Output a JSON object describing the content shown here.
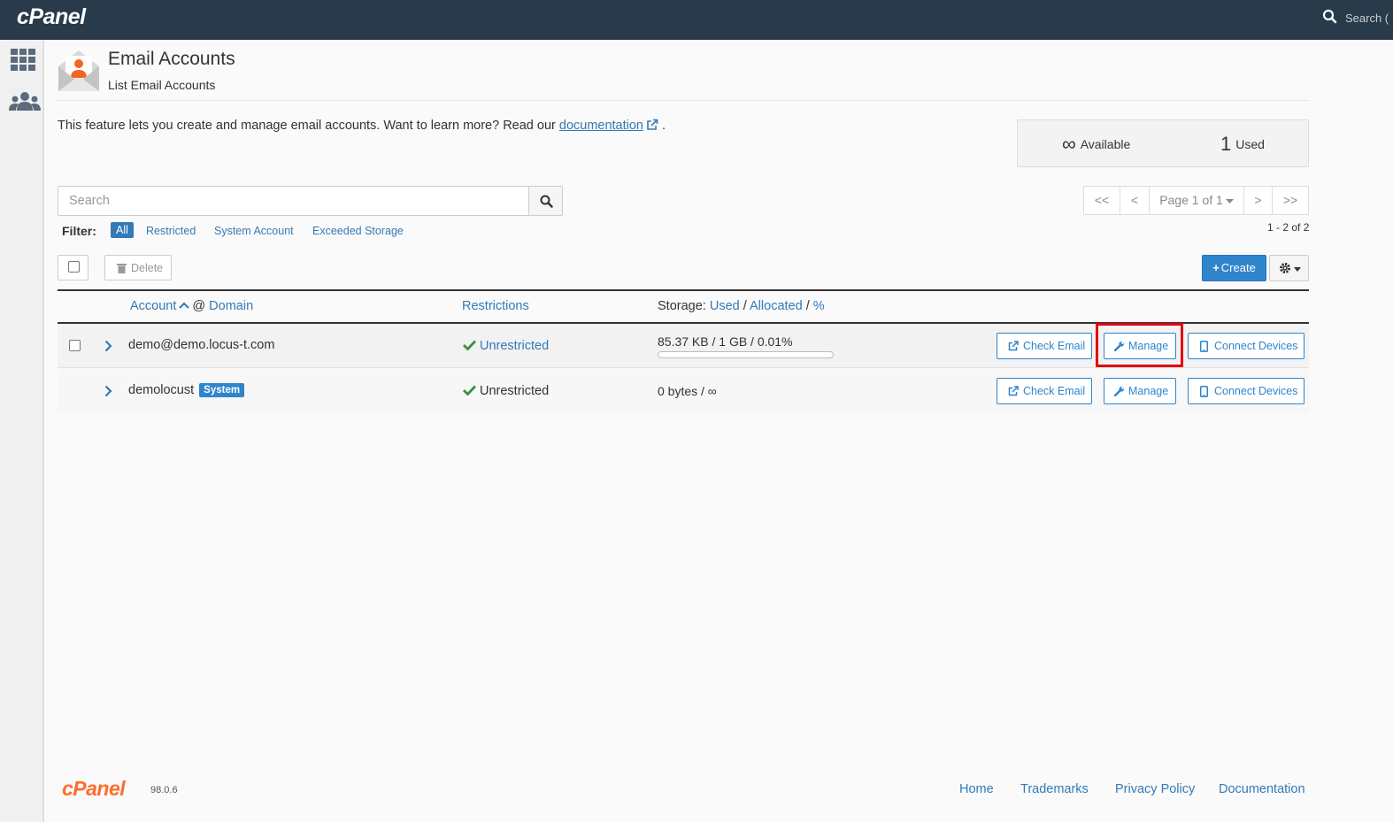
{
  "app": {
    "brand": "cPanel",
    "top_search_placeholder": "Search ("
  },
  "header": {
    "title": "Email Accounts",
    "subtitle": "List Email Accounts"
  },
  "intro": {
    "text": "This feature lets you create and manage email accounts. Want to learn more? Read our ",
    "link": "documentation",
    "suffix": "."
  },
  "stats": {
    "available_value": "∞",
    "available_label": "Available",
    "used_value": "1",
    "used_label": "Used"
  },
  "search": {
    "placeholder": "Search"
  },
  "filter": {
    "label": "Filter:",
    "options": [
      "All",
      "Restricted",
      "System Account",
      "Exceeded Storage"
    ],
    "active": "All"
  },
  "pagination": {
    "first": "<<",
    "prev": "<",
    "page_label": "Page 1 of 1",
    "next": ">",
    "last": ">>",
    "count": "1 - 2 of 2"
  },
  "toolbar": {
    "delete_label": "Delete",
    "create_label": "Create"
  },
  "table": {
    "headers": {
      "account": "Account",
      "at": "@",
      "domain": "Domain",
      "restrictions": "Restrictions",
      "storage_prefix": "Storage:",
      "used": "Used",
      "sep1": "/",
      "allocated": "Allocated",
      "sep2": "/",
      "percent": "%"
    },
    "rows": [
      {
        "account": "demo@demo.locus-t.com",
        "badge": "",
        "restriction": "Unrestricted",
        "storage": "85.37 KB / 1 GB / 0.01%",
        "usage_fraction": 0.0001
      },
      {
        "account": "demolocust",
        "badge": "System",
        "restriction": "Unrestricted",
        "storage": "0 bytes / ∞"
      }
    ],
    "actions": {
      "check_email": "Check Email",
      "manage": "Manage",
      "connect_devices": "Connect Devices"
    }
  },
  "footer": {
    "logo": "cPanel",
    "version": "98.0.6",
    "links": [
      "Home",
      "Trademarks",
      "Privacy Policy",
      "Documentation"
    ]
  },
  "colors": {
    "topbar": "#293a4a",
    "accent": "#2f85cc",
    "highlight": "#e3000f",
    "check": "#3c8f3c",
    "brand_orange": "#ff6c2c"
  }
}
